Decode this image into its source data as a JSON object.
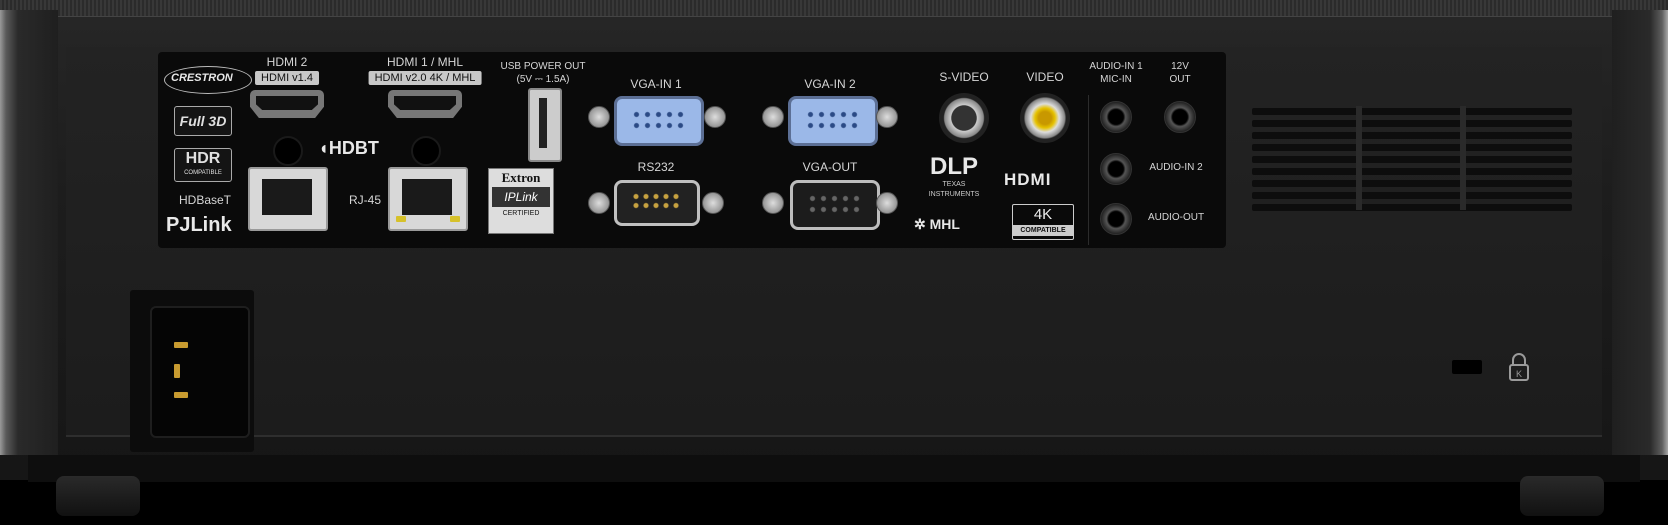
{
  "labels": {
    "hdmi2": "HDMI 2",
    "hdmi2_chip": "HDMI v1.4",
    "hdmi1": "HDMI 1 / MHL",
    "hdmi1_chip": "HDMI v2.0 4K / MHL",
    "usb_line1": "USB POWER OUT",
    "usb_line2": "(5V ⎓ 1.5A)",
    "vga_in1": "VGA-IN 1",
    "vga_in2": "VGA-IN 2",
    "rs232": "RS232",
    "vga_out": "VGA-OUT",
    "svideo": "S-VIDEO",
    "video": "VIDEO",
    "audio_in1_line1": "AUDIO-IN 1",
    "audio_in1_line2": "MIC-IN",
    "out12v_line1": "12V",
    "out12v_line2": "OUT",
    "audio_in2": "AUDIO-IN 2",
    "audio_out": "AUDIO-OUT",
    "hdbaset": "HDBaseT",
    "rj45": "RJ-45"
  },
  "logos": {
    "crestron": "CRESTRON",
    "full3d": "Full 3D",
    "hdr": "HDR",
    "hdr_sub": "COMPATIBLE",
    "pjlink": "PJLink",
    "hdbt": "HDBT",
    "extron": "Extron",
    "iplink": "IPLink",
    "certified": "CERTIFIED",
    "dlp": "DLP",
    "dlp_sub": "TEXAS INSTRUMENTS",
    "hdmi": "HDMI",
    "mhl": "MHL",
    "k4": "4K",
    "k4_sub": "COMPATIBLE"
  },
  "colors": {
    "vga_in": "#9bb8e8",
    "rca_video": "#e6c200",
    "pins": "#c89b30"
  }
}
